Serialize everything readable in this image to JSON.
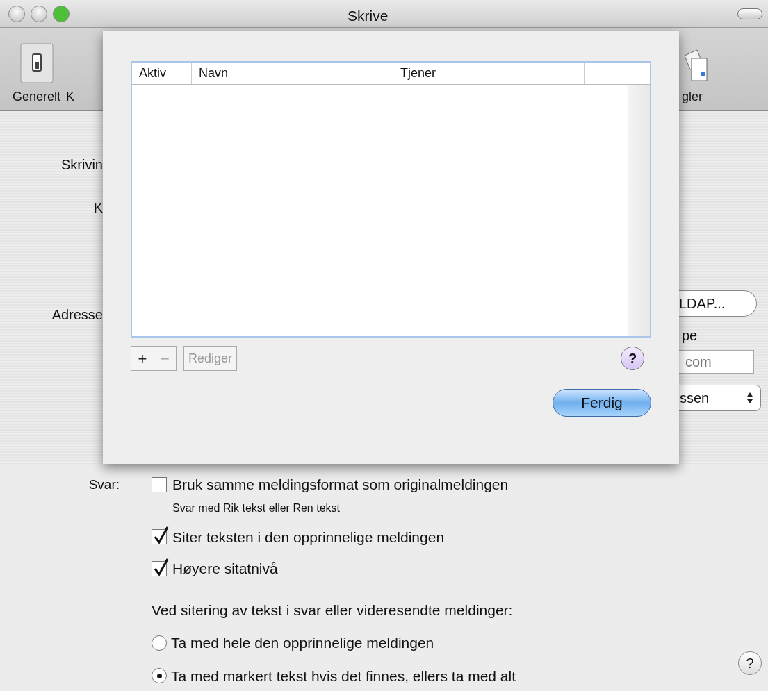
{
  "window": {
    "title": "Skrive",
    "buttons": [
      {
        "kind": "close",
        "enabled": false
      },
      {
        "kind": "minimize",
        "enabled": false
      },
      {
        "kind": "zoom",
        "enabled": true
      }
    ]
  },
  "toolbar": {
    "left_items": [
      {
        "label": "Generelt",
        "kind": "switch"
      },
      {
        "label": "K",
        "kind": "hidden"
      }
    ],
    "right_items": [
      {
        "label": "gler",
        "kind": "rules"
      }
    ]
  },
  "background": {
    "left_labels": [
      "Skrivin",
      "K",
      "Adresse"
    ],
    "ldap_button": "LDAP...",
    "right_text": "pe",
    "domain_field": "com",
    "popup": "ssen"
  },
  "sheet": {
    "columns": [
      "Aktiv",
      "Navn",
      "Tjener"
    ],
    "buttons": [
      {
        "label": "+",
        "disabled": false
      },
      {
        "label": "−",
        "disabled": true
      }
    ],
    "edit_button": {
      "label": "Rediger",
      "disabled": true
    },
    "help": "?",
    "done": "Ferdig"
  },
  "reply": {
    "label": "Svar:",
    "options": [
      {
        "kind": "checkbox",
        "label": "Bruk samme meldingsformat som originalmeldingen",
        "checked": false,
        "note": "Svar med Rik tekst eller Ren tekst"
      },
      {
        "kind": "checkbox",
        "label": "Siter teksten i den opprinnelige meldingen",
        "checked": true
      },
      {
        "kind": "checkbox",
        "label": "Høyere sitatnivå",
        "checked": true
      }
    ],
    "quote_heading": "Ved sitering av tekst i svar eller videresendte meldinger:",
    "quote_options": [
      {
        "label": "Ta med hele den opprinnelige meldingen",
        "selected": false
      },
      {
        "label": "Ta med markert tekst hvis det finnes, ellers ta med alt",
        "selected": true
      }
    ],
    "help": "?"
  }
}
